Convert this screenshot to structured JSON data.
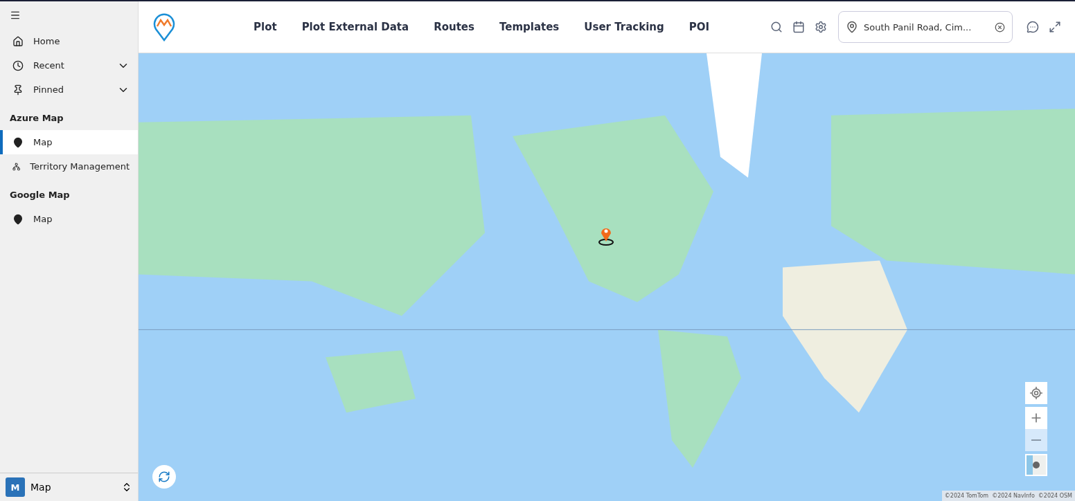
{
  "sidebar": {
    "items": [
      {
        "kind": "link",
        "label": "Home",
        "selected": false
      },
      {
        "kind": "expandable",
        "label": "Recent",
        "expanded": false,
        "selected": false
      },
      {
        "kind": "expandable",
        "label": "Pinned",
        "expanded": false,
        "selected": false
      }
    ],
    "groups": [
      {
        "title": "Azure Map",
        "items": [
          {
            "label": "Map",
            "selected": true
          },
          {
            "label": "Territory Management",
            "selected": false
          }
        ]
      },
      {
        "title": "Google Map",
        "items": [
          {
            "label": "Map",
            "selected": false
          }
        ]
      }
    ],
    "area_switcher": {
      "initial": "M",
      "label": "Map"
    }
  },
  "top_nav": {
    "items": [
      {
        "label": "Plot"
      },
      {
        "label": "Plot External Data"
      },
      {
        "label": "Routes"
      },
      {
        "label": "Templates"
      },
      {
        "label": "User Tracking"
      },
      {
        "label": "POI"
      }
    ],
    "location_field": {
      "value": "South Panil Road, Cim..."
    }
  },
  "map": {
    "attribution": [
      "©2024 TomTom",
      "©2024 NavInfo",
      "©2024 OSM"
    ]
  }
}
